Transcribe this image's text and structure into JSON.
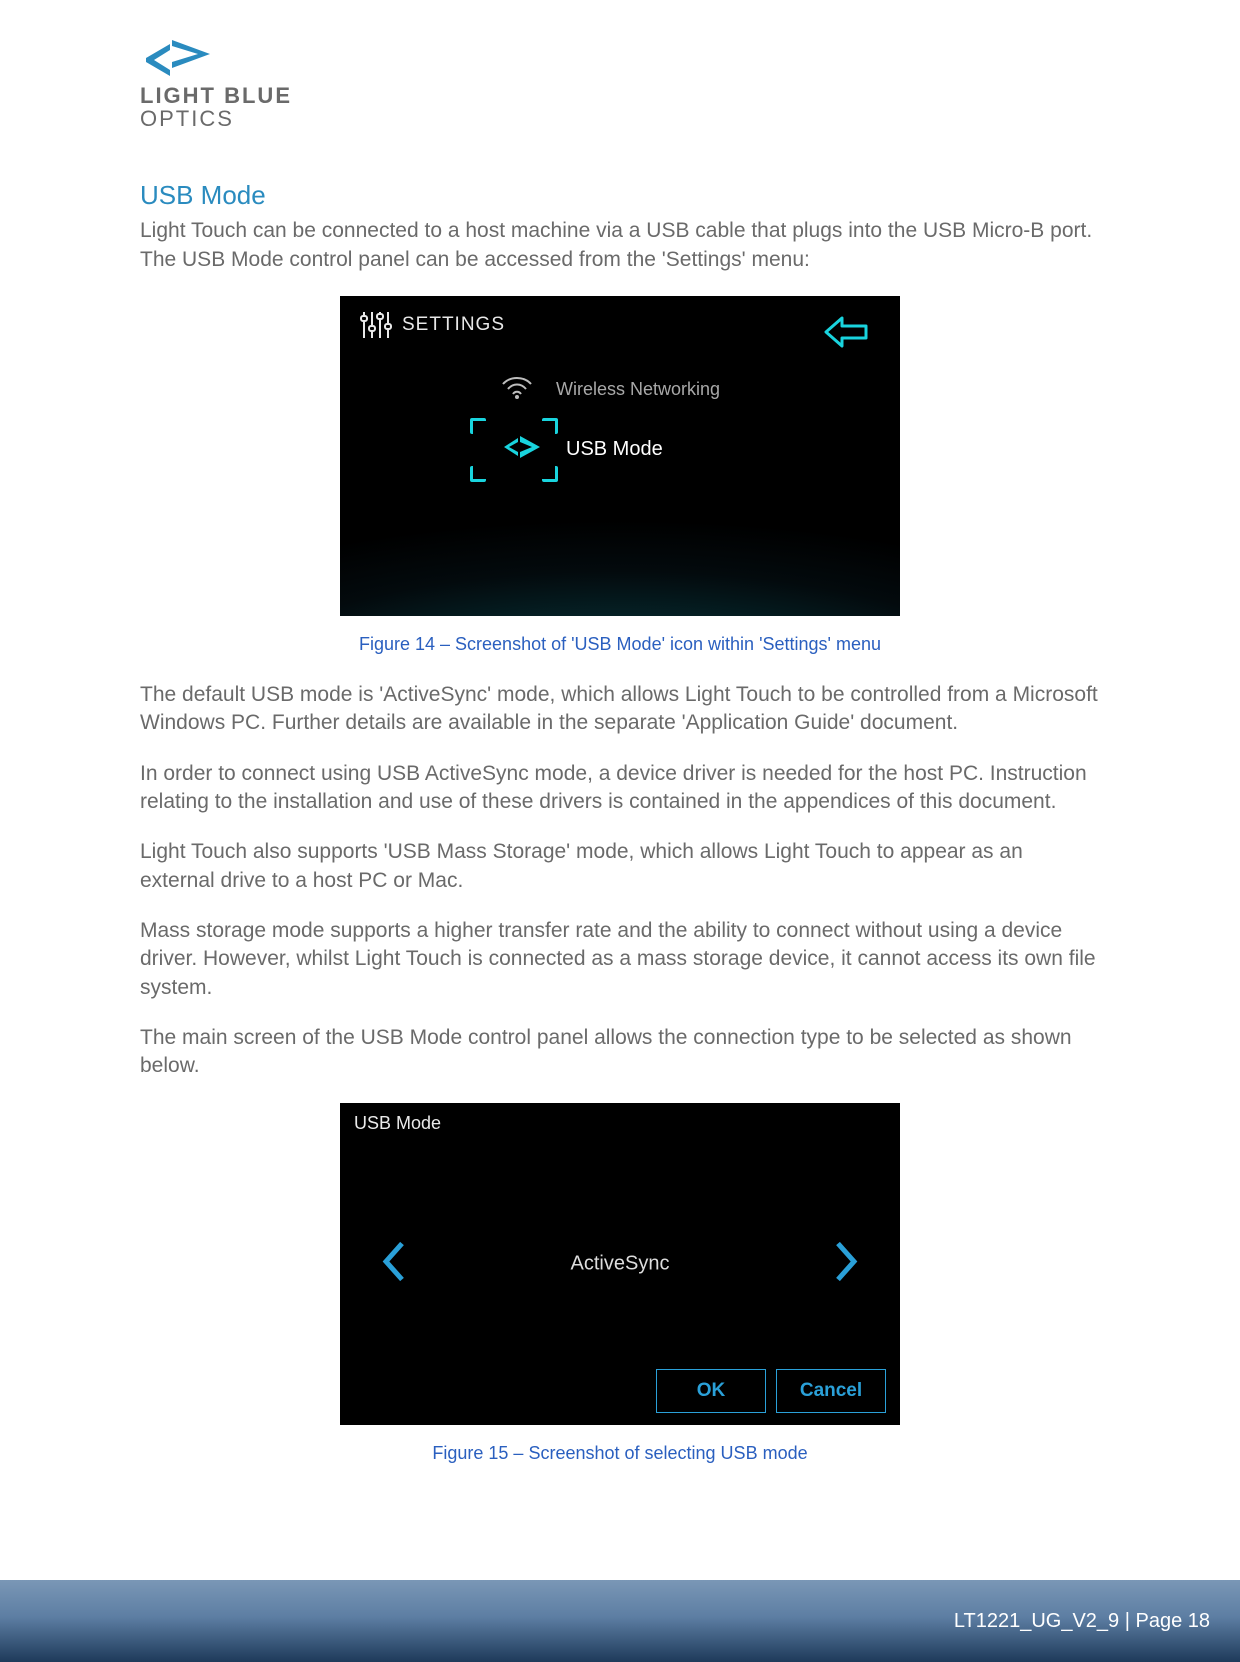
{
  "logo": {
    "line1": "LIGHT BLUE",
    "line2": "OPTICS"
  },
  "heading": "USB Mode",
  "para1": "Light Touch can be connected to a host machine via a USB cable that plugs into the USB Micro-B port. The USB Mode control panel can be accessed from the 'Settings' menu:",
  "shot1": {
    "title": "SETTINGS",
    "item_wifi": "Wireless Networking",
    "item_usb": "USB Mode"
  },
  "caption1": "Figure 14 – Screenshot of 'USB Mode' icon within 'Settings' menu",
  "para2": "The default USB mode is 'ActiveSync' mode, which allows Light Touch to be controlled from a Microsoft Windows PC. Further details are available in the separate 'Application Guide' document.",
  "para3": "In order to connect using USB ActiveSync mode, a device driver is needed for the host PC. Instruction relating to the installation and use of these drivers is contained in the appendices of this document.",
  "para4": "Light Touch also supports 'USB Mass Storage' mode, which allows Light Touch to appear as an external drive to a host PC or Mac.",
  "para5": "Mass storage mode supports a higher transfer rate and the ability to connect without using a device driver. However, whilst Light Touch is connected as a mass storage device, it cannot access its own file system.",
  "para6": "The main screen of the USB Mode control panel allows the connection type to be selected as shown below.",
  "shot2": {
    "title": "USB Mode",
    "mode": "ActiveSync",
    "ok": "OK",
    "cancel": "Cancel"
  },
  "caption2": "Figure 15 – Screenshot of selecting USB mode",
  "footer": "LT1221_UG_V2_9 | Page 18"
}
